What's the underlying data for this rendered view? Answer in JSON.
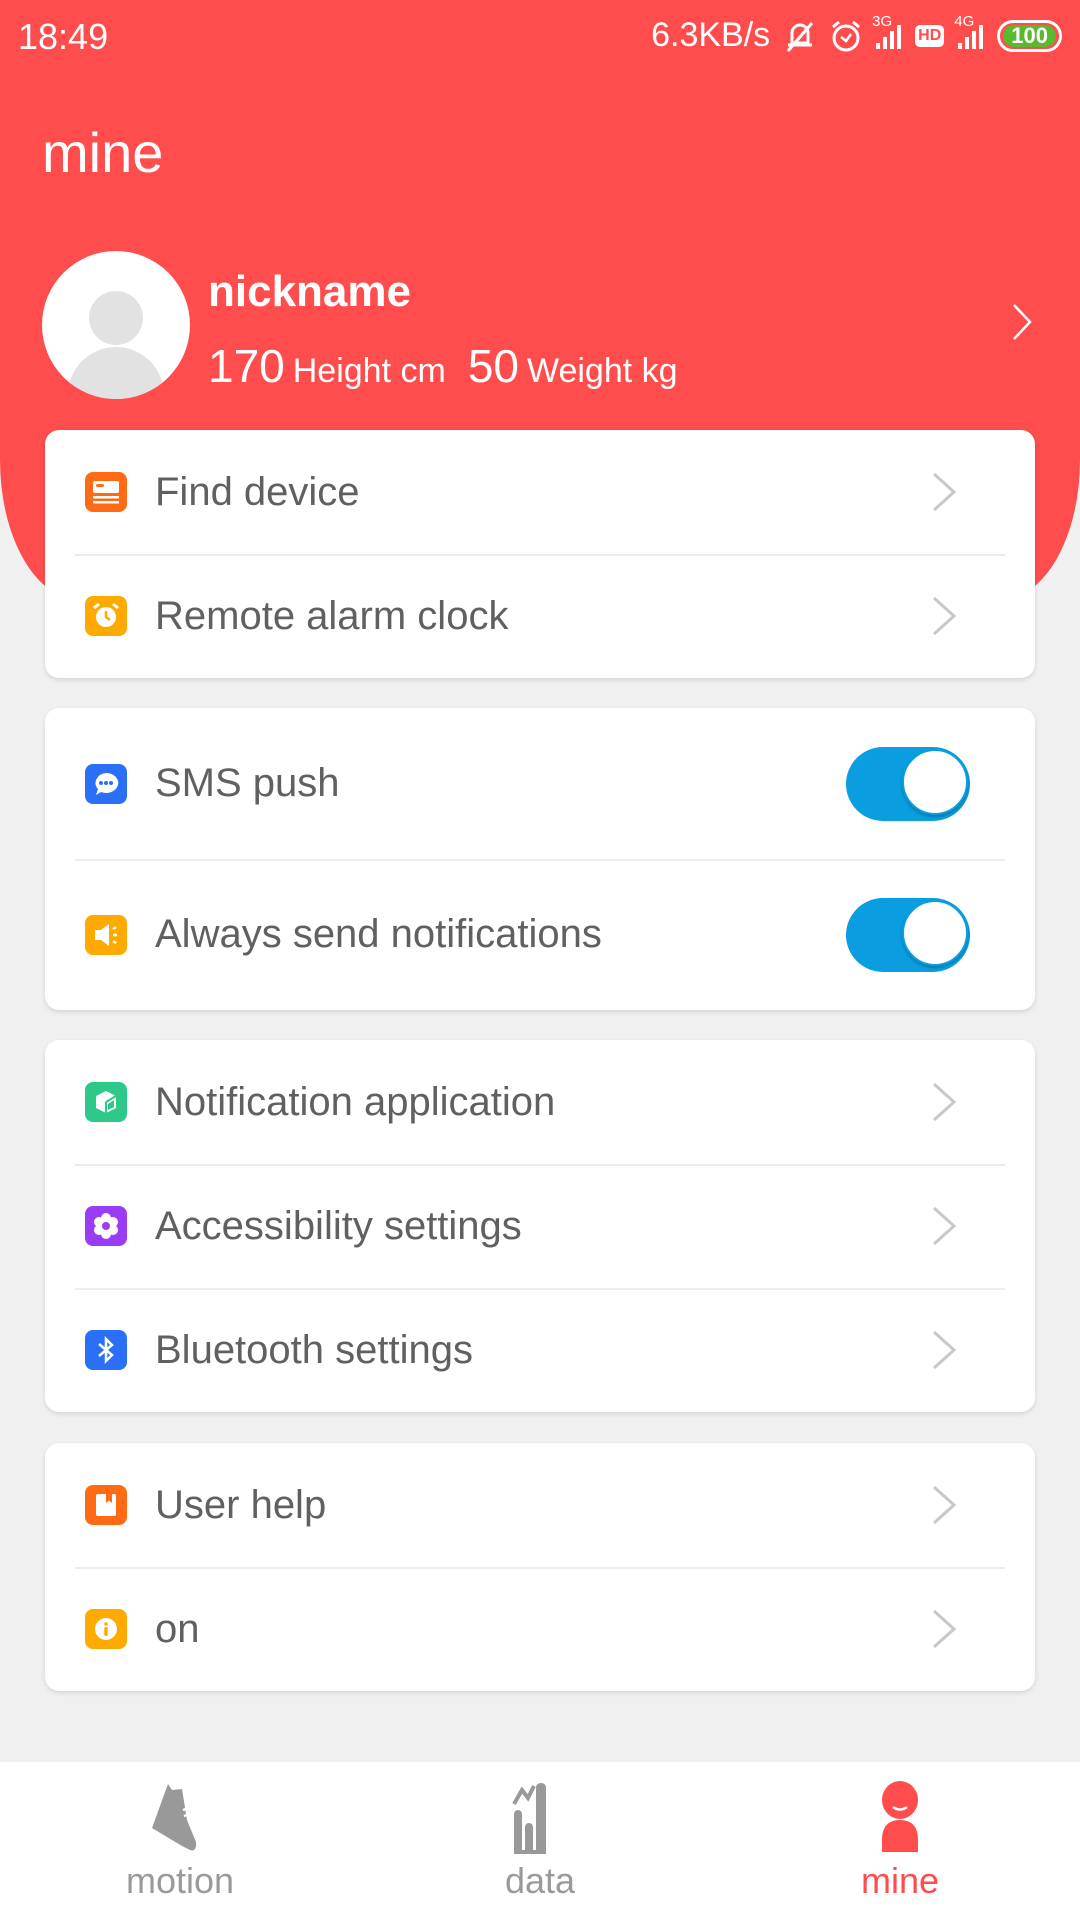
{
  "status_bar": {
    "time": "18:49",
    "network_speed": "6.3KB/s",
    "icons": [
      "bell-muted-icon",
      "alarm-icon",
      "signal-3g-icon",
      "hd-icon",
      "signal-4g-icon",
      "battery-icon"
    ],
    "sig1_label": "3G",
    "hd_label": "HD",
    "sig2_label": "4G",
    "battery": "100"
  },
  "header": {
    "title": "mine",
    "accent_color": "#ff4c4c"
  },
  "profile": {
    "nickname": "nickname",
    "height_value": "170",
    "height_unit": "Height cm",
    "weight_value": "50",
    "weight_unit": "Weight kg"
  },
  "cards": [
    {
      "items": [
        {
          "label": "Find device",
          "icon": "device-card-icon",
          "color": "#ff6a14",
          "control": "chevron"
        },
        {
          "label": "Remote alarm clock",
          "icon": "alarm-clock-icon",
          "color": "#ffaa00",
          "control": "chevron"
        }
      ]
    },
    {
      "items": [
        {
          "label": "SMS push",
          "icon": "message-icon",
          "color": "#2a6ff5",
          "control": "toggle",
          "checked": true
        },
        {
          "label": "Always send notifications",
          "icon": "speaker-icon",
          "color": "#ffaa00",
          "control": "toggle",
          "checked": true
        }
      ]
    },
    {
      "items": [
        {
          "label": "Notification application",
          "icon": "app-cube-icon",
          "color": "#2ec98a",
          "control": "chevron"
        },
        {
          "label": "Accessibility settings",
          "icon": "flower-gear-icon",
          "color": "#9b3cf5",
          "control": "chevron"
        },
        {
          "label": "Bluetooth settings",
          "icon": "bluetooth-icon",
          "color": "#2a6ff5",
          "control": "chevron"
        }
      ]
    },
    {
      "items": [
        {
          "label": "User help",
          "icon": "bookmark-book-icon",
          "color": "#ff6a14",
          "control": "chevron"
        },
        {
          "label": "on",
          "icon": "info-icon",
          "color": "#ffaa00",
          "control": "chevron"
        }
      ]
    }
  ],
  "toggle_color": "#0a9ee0",
  "bottom_nav": {
    "items": [
      {
        "label": "motion",
        "icon": "shoe-icon",
        "active": false
      },
      {
        "label": "data",
        "icon": "bar-chart-icon",
        "active": false
      },
      {
        "label": "mine",
        "icon": "person-icon",
        "active": true
      }
    ]
  }
}
